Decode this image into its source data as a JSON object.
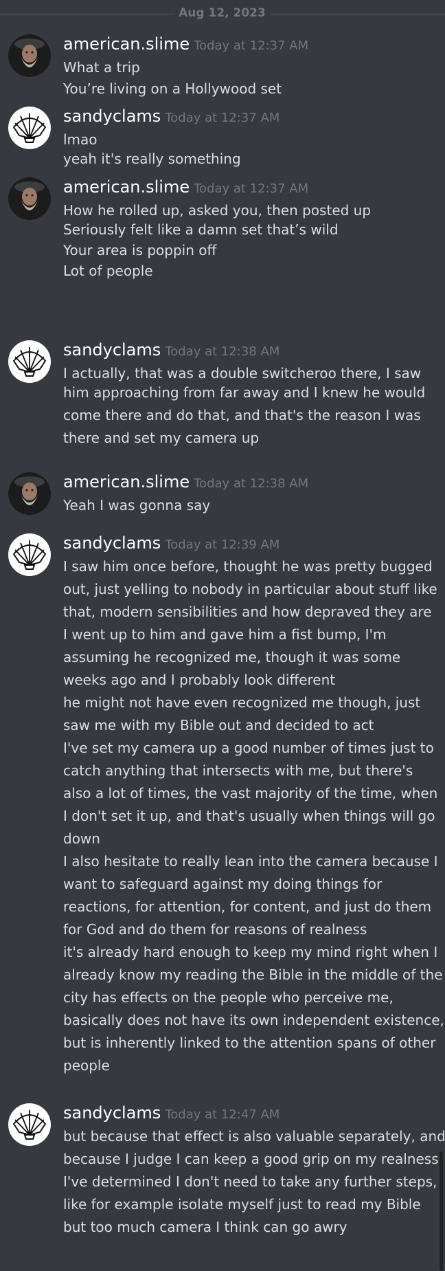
{
  "date_divider": "Aug 12, 2023",
  "groups": [
    {
      "username": "american.slime",
      "timestamp": "Today at 12:37 AM",
      "avatar": "bearded-man-avatar",
      "lines": [
        "What a trip",
        "You’re living on a Hollywood set"
      ]
    },
    {
      "username": "sandyclams",
      "timestamp": "Today at 12:37 AM",
      "avatar": "shell-icon",
      "lines": [
        "lmao",
        "yeah it's really something"
      ]
    },
    {
      "username": "american.slime",
      "timestamp": "Today at 12:37 AM",
      "avatar": "bearded-man-avatar",
      "lines": [
        "How he rolled up, asked you, then posted up",
        "Seriously felt like a damn set that’s wild",
        "Your area is poppin off",
        "Lot of people"
      ]
    },
    {
      "username": "sandyclams",
      "timestamp": "Today at 12:38 AM",
      "avatar": "shell-icon",
      "lines": [
        "I actually, that was a double switcheroo there, I saw",
        "him approaching from far away and I knew he would",
        "come there and do that, and that's the reason I was",
        "there and set my camera up"
      ]
    },
    {
      "username": "american.slime",
      "timestamp": "Today at 12:38 AM",
      "avatar": "bearded-man-avatar",
      "lines": [
        "Yeah I was gonna say"
      ]
    },
    {
      "username": "sandyclams",
      "timestamp": "Today at 12:39 AM",
      "avatar": "shell-icon",
      "lines": [
        "I saw him once before, thought he was pretty bugged",
        "out, just yelling to nobody in particular about stuff like",
        "that, modern sensibilities and how depraved they are",
        "I went up to him and gave him a fist bump, I'm",
        "assuming he recognized me, though it was some",
        "weeks ago and I probably look different",
        "he might not have even recognized me though, just",
        "saw me with my Bible out and decided to act",
        "I've set my camera up a good number of times just to",
        "catch anything that intersects with me, but there's",
        "also a lot of times, the vast majority of the time, when",
        "I don't set it up, and that's usually when things will go",
        "down",
        "I also hesitate to really lean into the camera because I",
        "want to safeguard against my doing things for",
        "reactions, for attention, for content, and just do them",
        "for God and do them for reasons of realness",
        "it's already hard enough to keep my mind right when I",
        "already know my reading the Bible in the middle of the",
        "city has effects on the people who perceive me,",
        "basically does not have its own independent existence,",
        "but is inherently linked to the attention spans of other",
        "people"
      ]
    },
    {
      "username": "sandyclams",
      "timestamp": "Today at 12:47 AM",
      "avatar": "shell-icon",
      "lines": [
        "but because that effect is also valuable separately, and",
        "because I judge I can keep a good grip on my realness,",
        "I've determined I don't need to take any further steps,",
        "like for example isolate myself just to read my Bible",
        "but too much camera I think can go awry"
      ]
    }
  ]
}
